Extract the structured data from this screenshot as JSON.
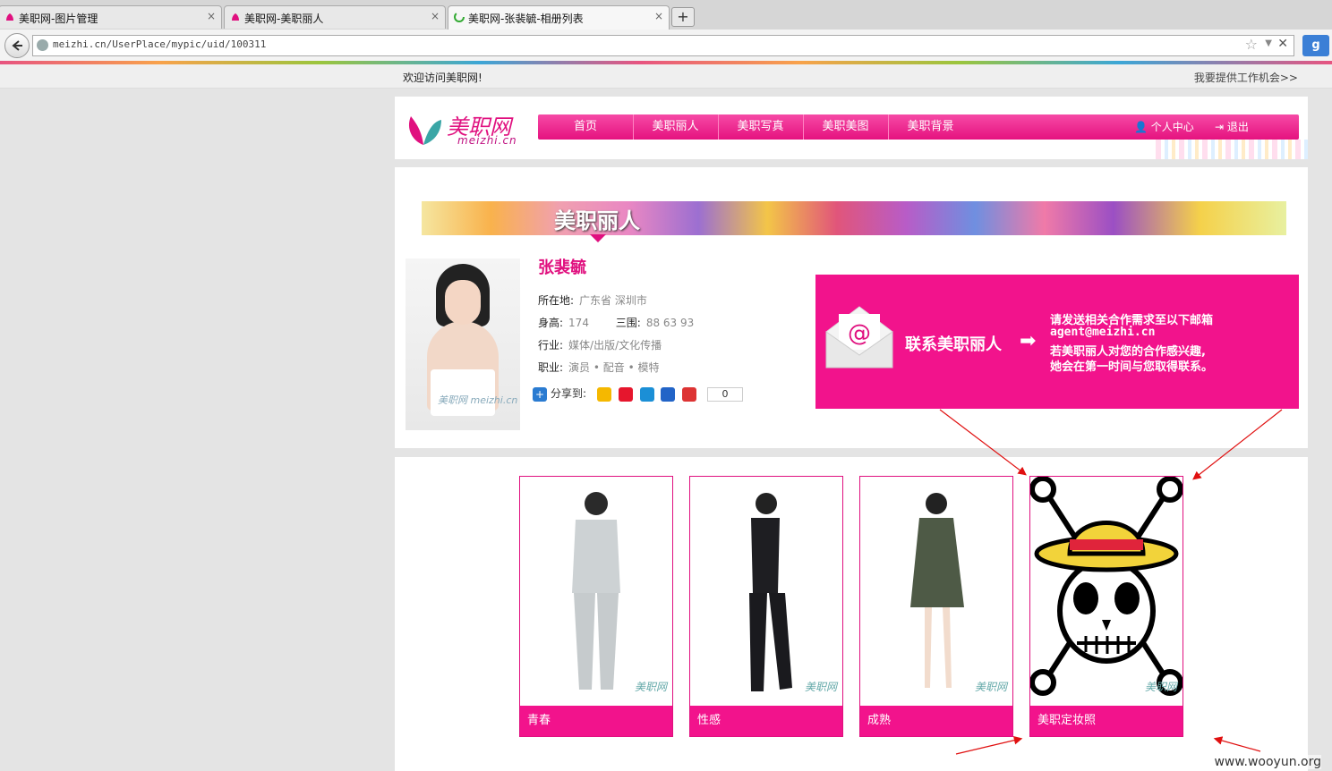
{
  "browser": {
    "tabs": [
      {
        "title": "美职网-图片管理",
        "active": false
      },
      {
        "title": "美职网-美职丽人",
        "active": false
      },
      {
        "title": "美职网-张裴毓-相册列表",
        "active": true
      }
    ],
    "close_glyph": "×",
    "new_tab_glyph": "+",
    "url": "meizhi.cn/UserPlace/mypic/uid/100311",
    "search_engine": "g"
  },
  "topbar": {
    "welcome": "欢迎访问美职网!",
    "offer_link": "我要提供工作机会>>"
  },
  "header": {
    "logo_text": "美职网",
    "logo_sub": "meizhi.cn",
    "menu": [
      "首页",
      "美职丽人",
      "美职写真",
      "美职美图",
      "美职背景"
    ],
    "user_center": "个人中心",
    "logout": "退出"
  },
  "profile": {
    "banner_title": "美职丽人",
    "photo_watermark": "美职网 meizhi.cn",
    "name": "张裴毓",
    "location_label": "所在地:",
    "location_value": "广东省  深圳市",
    "height_label": "身高:",
    "height_value": "174",
    "measure_label": "三围:",
    "measure_value": "88 63 93",
    "industry_label": "行业:",
    "industry_value": "媒体/出版/文化传播",
    "job_label": "职业:",
    "job_value": "演员 • 配音 • 模特",
    "share_label": "分享到:",
    "share_count": "0"
  },
  "contact": {
    "title": "联系美职丽人",
    "lines": [
      "请发送相关合作需求至以下邮箱",
      "agent@meizhi.cn",
      "若美职丽人对您的合作感兴趣,",
      "她会在第一时间与您取得联系。"
    ]
  },
  "albums": [
    {
      "caption": "青春",
      "watermark": "美职网"
    },
    {
      "caption": "性感",
      "watermark": "美职网"
    },
    {
      "caption": "成熟",
      "watermark": "美职网"
    },
    {
      "caption": "美职定妆照",
      "watermark": "美职网"
    }
  ],
  "watermark": "www.wooyun.org",
  "colors": {
    "brand": "#e0107f",
    "accent": "#f2138c"
  }
}
